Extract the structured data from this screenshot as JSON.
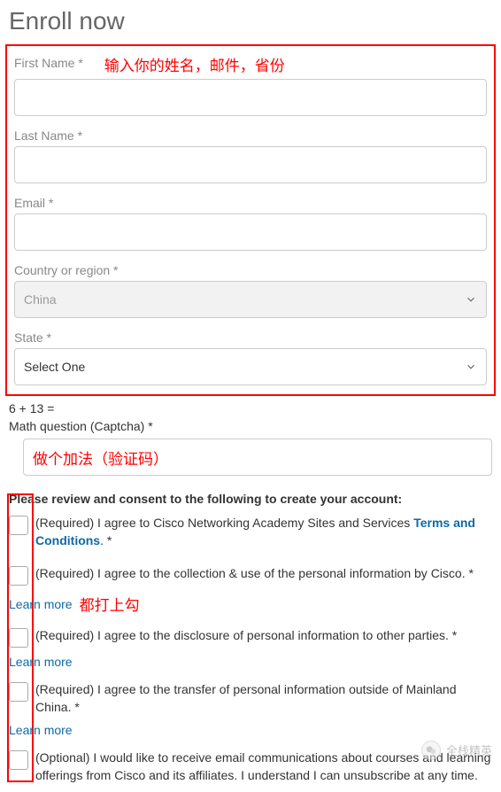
{
  "title": "Enroll now",
  "annotations": {
    "form_hint": "输入你的姓名，邮件，省份",
    "captcha_hint": "做个加法（验证码）",
    "check_hint": "都打上勾"
  },
  "fields": {
    "first_name_label": "First Name *",
    "last_name_label": "Last Name *",
    "email_label": "Email *",
    "country_label": "Country or region *",
    "country_value": "China",
    "state_label": "State *",
    "state_value": "Select One"
  },
  "captcha": {
    "question": "6 + 13 =",
    "label": "Math question (Captcha) *"
  },
  "consent": {
    "heading": "Please review and consent to the following to create your account:",
    "items": [
      {
        "prefix": "(Required) I agree to Cisco Networking Academy Sites and Services ",
        "link_text": "Terms and Conditions",
        "suffix": ". *",
        "learn_more": null
      },
      {
        "prefix": "(Required) I agree to the collection & use of the personal information by Cisco. *",
        "link_text": null,
        "suffix": "",
        "learn_more": "Learn more"
      },
      {
        "prefix": "(Required) I agree to the disclosure of personal information to other parties. *",
        "link_text": null,
        "suffix": "",
        "learn_more": "Learn more"
      },
      {
        "prefix": "(Required) I agree to the transfer of personal information outside of Mainland China. *",
        "link_text": null,
        "suffix": "",
        "learn_more": "Learn more"
      },
      {
        "prefix": "(Optional) I would like to receive email communications about courses and learning offerings from Cisco and its affiliates. I understand I can unsubscribe at any time.",
        "link_text": null,
        "suffix": "",
        "learn_more": null
      }
    ]
  },
  "watermark": "全栈精英"
}
